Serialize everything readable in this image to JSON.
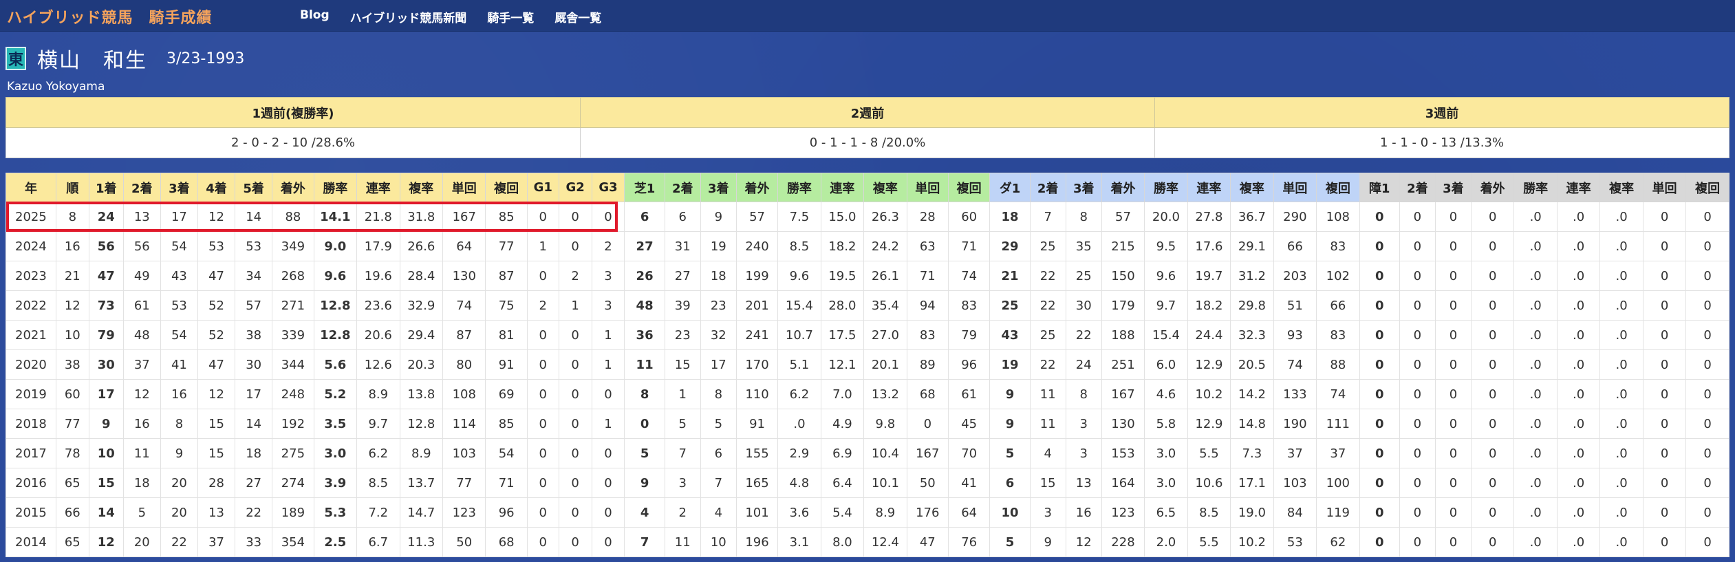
{
  "nav": {
    "brand": "ハイブリッド競馬　騎手成績",
    "links": [
      "Blog",
      "ハイブリッド競馬新聞",
      "騎手一覧",
      "厩舎一覧"
    ]
  },
  "jockey": {
    "affiliation": "東",
    "name": "横山　和生",
    "birth": "3/23-1993",
    "roman": "Kazuo Yokoyama"
  },
  "weekly": {
    "headers": [
      "1週前(複勝率)",
      "2週前",
      "3週前"
    ],
    "values": [
      "2 - 0 - 2 - 10 /28.6%",
      "0 - 1 - 1 - 8 /20.0%",
      "1 - 1 - 0 - 13 /13.3%"
    ]
  },
  "results": {
    "headers": [
      "年",
      "順",
      "1着",
      "2着",
      "3着",
      "4着",
      "5着",
      "着外",
      "勝率",
      "連率",
      "複率",
      "単回",
      "複回",
      "G1",
      "G2",
      "G3",
      "芝1",
      "2着",
      "3着",
      "着外",
      "勝率",
      "連率",
      "複率",
      "単回",
      "複回",
      "ダ1",
      "2着",
      "3着",
      "着外",
      "勝率",
      "連率",
      "複率",
      "単回",
      "複回",
      "障1",
      "2着",
      "3着",
      "着外",
      "勝率",
      "連率",
      "複率",
      "単回",
      "複回"
    ],
    "rows": [
      [
        "2025",
        "8",
        "24",
        "13",
        "17",
        "12",
        "14",
        "88",
        "14.1",
        "21.8",
        "31.8",
        "167",
        "85",
        "0",
        "0",
        "0",
        "6",
        "6",
        "9",
        "57",
        "7.5",
        "15.0",
        "26.3",
        "28",
        "60",
        "18",
        "7",
        "8",
        "57",
        "20.0",
        "27.8",
        "36.7",
        "290",
        "108",
        "0",
        "0",
        "0",
        "0",
        ".0",
        ".0",
        ".0",
        "0",
        "0"
      ],
      [
        "2024",
        "16",
        "56",
        "56",
        "54",
        "53",
        "53",
        "349",
        "9.0",
        "17.9",
        "26.6",
        "64",
        "77",
        "1",
        "0",
        "2",
        "27",
        "31",
        "19",
        "240",
        "8.5",
        "18.2",
        "24.2",
        "63",
        "71",
        "29",
        "25",
        "35",
        "215",
        "9.5",
        "17.6",
        "29.1",
        "66",
        "83",
        "0",
        "0",
        "0",
        "0",
        ".0",
        ".0",
        ".0",
        "0",
        "0"
      ],
      [
        "2023",
        "21",
        "47",
        "49",
        "43",
        "47",
        "34",
        "268",
        "9.6",
        "19.6",
        "28.4",
        "130",
        "87",
        "0",
        "2",
        "3",
        "26",
        "27",
        "18",
        "199",
        "9.6",
        "19.5",
        "26.1",
        "71",
        "74",
        "21",
        "22",
        "25",
        "150",
        "9.6",
        "19.7",
        "31.2",
        "203",
        "102",
        "0",
        "0",
        "0",
        "0",
        ".0",
        ".0",
        ".0",
        "0",
        "0"
      ],
      [
        "2022",
        "12",
        "73",
        "61",
        "53",
        "52",
        "57",
        "271",
        "12.8",
        "23.6",
        "32.9",
        "74",
        "75",
        "2",
        "1",
        "3",
        "48",
        "39",
        "23",
        "201",
        "15.4",
        "28.0",
        "35.4",
        "94",
        "83",
        "25",
        "22",
        "30",
        "179",
        "9.7",
        "18.2",
        "29.8",
        "51",
        "66",
        "0",
        "0",
        "0",
        "0",
        ".0",
        ".0",
        ".0",
        "0",
        "0"
      ],
      [
        "2021",
        "10",
        "79",
        "48",
        "54",
        "52",
        "38",
        "339",
        "12.8",
        "20.6",
        "29.4",
        "87",
        "81",
        "0",
        "0",
        "1",
        "36",
        "23",
        "32",
        "241",
        "10.7",
        "17.5",
        "27.0",
        "83",
        "79",
        "43",
        "25",
        "22",
        "188",
        "15.4",
        "24.4",
        "32.3",
        "93",
        "83",
        "0",
        "0",
        "0",
        "0",
        ".0",
        ".0",
        ".0",
        "0",
        "0"
      ],
      [
        "2020",
        "38",
        "30",
        "37",
        "41",
        "47",
        "30",
        "344",
        "5.6",
        "12.6",
        "20.3",
        "80",
        "91",
        "0",
        "0",
        "1",
        "11",
        "15",
        "17",
        "170",
        "5.1",
        "12.1",
        "20.1",
        "89",
        "96",
        "19",
        "22",
        "24",
        "251",
        "6.0",
        "12.9",
        "20.5",
        "74",
        "88",
        "0",
        "0",
        "0",
        "0",
        ".0",
        ".0",
        ".0",
        "0",
        "0"
      ],
      [
        "2019",
        "60",
        "17",
        "12",
        "16",
        "12",
        "17",
        "248",
        "5.2",
        "8.9",
        "13.8",
        "108",
        "69",
        "0",
        "0",
        "0",
        "8",
        "1",
        "8",
        "110",
        "6.2",
        "7.0",
        "13.2",
        "68",
        "61",
        "9",
        "11",
        "8",
        "167",
        "4.6",
        "10.2",
        "14.2",
        "133",
        "74",
        "0",
        "0",
        "0",
        "0",
        ".0",
        ".0",
        ".0",
        "0",
        "0"
      ],
      [
        "2018",
        "77",
        "9",
        "16",
        "8",
        "15",
        "14",
        "192",
        "3.5",
        "9.7",
        "12.8",
        "114",
        "85",
        "0",
        "0",
        "1",
        "0",
        "5",
        "5",
        "91",
        ".0",
        "4.9",
        "9.8",
        "0",
        "45",
        "9",
        "11",
        "3",
        "130",
        "5.8",
        "12.9",
        "14.8",
        "190",
        "111",
        "0",
        "0",
        "0",
        "0",
        ".0",
        ".0",
        ".0",
        "0",
        "0"
      ],
      [
        "2017",
        "78",
        "10",
        "11",
        "9",
        "15",
        "18",
        "275",
        "3.0",
        "6.2",
        "8.9",
        "103",
        "54",
        "0",
        "0",
        "0",
        "5",
        "7",
        "6",
        "155",
        "2.9",
        "6.9",
        "10.4",
        "167",
        "70",
        "5",
        "4",
        "3",
        "153",
        "3.0",
        "5.5",
        "7.3",
        "37",
        "37",
        "0",
        "0",
        "0",
        "0",
        ".0",
        ".0",
        ".0",
        "0",
        "0"
      ],
      [
        "2016",
        "65",
        "15",
        "18",
        "20",
        "28",
        "27",
        "274",
        "3.9",
        "8.5",
        "13.7",
        "77",
        "71",
        "0",
        "0",
        "0",
        "9",
        "3",
        "7",
        "165",
        "4.8",
        "6.4",
        "10.1",
        "50",
        "41",
        "6",
        "15",
        "13",
        "164",
        "3.0",
        "10.6",
        "17.1",
        "103",
        "100",
        "0",
        "0",
        "0",
        "0",
        ".0",
        ".0",
        ".0",
        "0",
        "0"
      ],
      [
        "2015",
        "66",
        "14",
        "5",
        "20",
        "13",
        "22",
        "189",
        "5.3",
        "7.2",
        "14.7",
        "123",
        "96",
        "0",
        "0",
        "0",
        "4",
        "2",
        "4",
        "101",
        "3.6",
        "5.4",
        "8.9",
        "176",
        "64",
        "10",
        "3",
        "16",
        "123",
        "6.5",
        "8.5",
        "19.0",
        "84",
        "119",
        "0",
        "0",
        "0",
        "0",
        ".0",
        ".0",
        ".0",
        "0",
        "0"
      ],
      [
        "2014",
        "65",
        "12",
        "20",
        "22",
        "37",
        "33",
        "354",
        "2.5",
        "6.7",
        "11.3",
        "50",
        "68",
        "0",
        "0",
        "0",
        "7",
        "11",
        "10",
        "196",
        "3.1",
        "8.0",
        "12.4",
        "47",
        "76",
        "5",
        "9",
        "12",
        "228",
        "2.0",
        "5.5",
        "10.2",
        "53",
        "62",
        "0",
        "0",
        "0",
        "0",
        ".0",
        ".0",
        ".0",
        "0",
        "0"
      ]
    ]
  },
  "colors": {
    "background": "#2b4a9c",
    "navbar": "#1f3a7d",
    "brand": "#f5a35c",
    "header_all": "#fbe99d",
    "header_turf": "#b6eca0",
    "header_dirt": "#bfd4f7",
    "header_jump": "#d8d8d8",
    "highlight": "#e0192b"
  }
}
